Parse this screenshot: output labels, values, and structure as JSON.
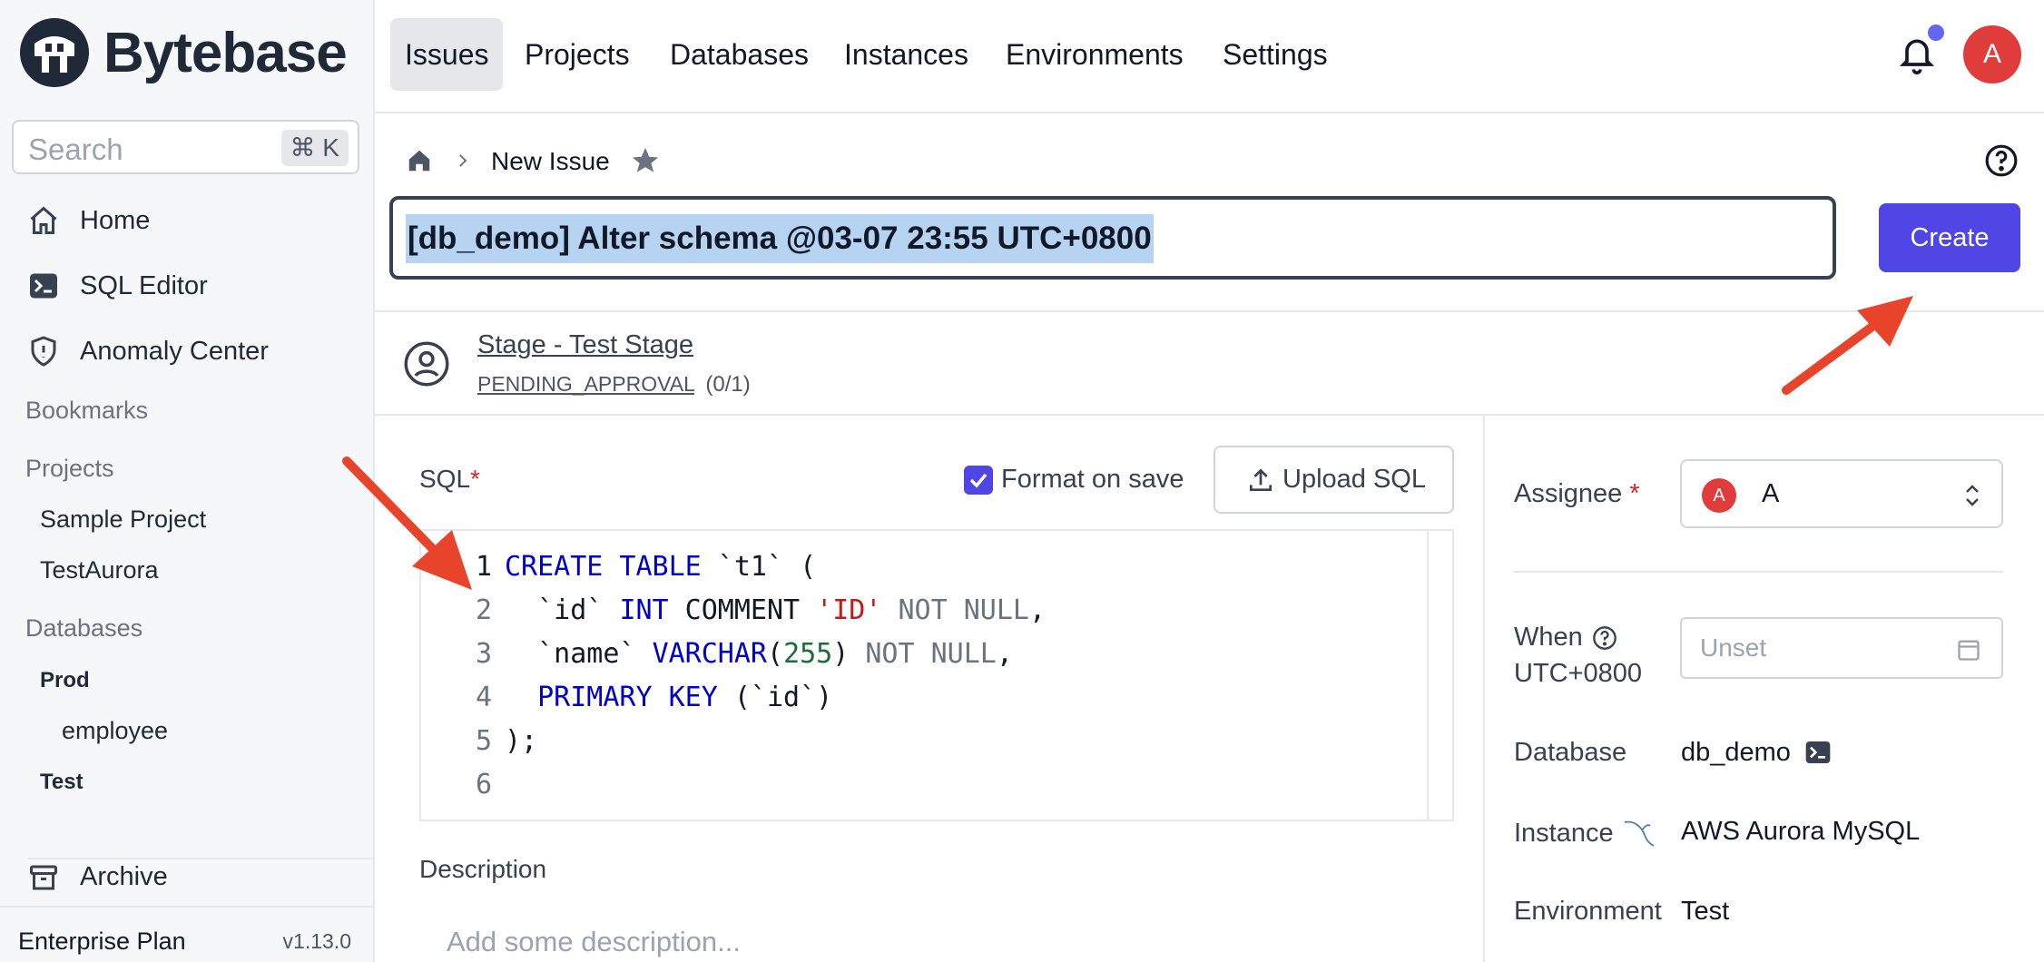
{
  "app": {
    "name": "Bytebase"
  },
  "search": {
    "placeholder": "Search",
    "shortcut": "⌘ K"
  },
  "sidebar": {
    "nav": [
      {
        "label": "Home",
        "icon": "home-icon"
      },
      {
        "label": "SQL Editor",
        "icon": "terminal-icon"
      },
      {
        "label": "Anomaly Center",
        "icon": "shield-icon"
      }
    ],
    "bookmarks_label": "Bookmarks",
    "projects_label": "Projects",
    "projects": [
      "Sample Project",
      "TestAurora"
    ],
    "databases_label": "Databases",
    "env_prod": "Prod",
    "db_employee": "employee",
    "env_test": "Test",
    "archive_label": "Archive",
    "plan": "Enterprise Plan",
    "version": "v1.13.0"
  },
  "topnav": {
    "tabs": [
      "Issues",
      "Projects",
      "Databases",
      "Instances",
      "Environments",
      "Settings"
    ],
    "active_tab": "Issues",
    "avatar_letter": "A"
  },
  "breadcrumb": {
    "current": "New Issue"
  },
  "issue": {
    "title": "[db_demo] Alter schema @03-07 23:55 UTC+0800",
    "create_label": "Create"
  },
  "stage": {
    "name": "Stage - Test Stage",
    "status": "PENDING_APPROVAL",
    "progress": "(0/1)"
  },
  "sql": {
    "label": "SQL",
    "required_mark": "*",
    "format_on_save_label": "Format on save",
    "format_on_save_checked": true,
    "upload_label": "Upload SQL",
    "line_numbers": [
      "1",
      "2",
      "3",
      "4",
      "5",
      "6"
    ]
  },
  "description": {
    "label": "Description",
    "placeholder": "Add some description..."
  },
  "details": {
    "assignee_label": "Assignee",
    "required_mark": "*",
    "assignee_avatar": "A",
    "assignee_name": "A",
    "when_label": "When",
    "when_tz": "UTC+0800",
    "when_placeholder": "Unset",
    "database_label": "Database",
    "database_value": "db_demo",
    "instance_label": "Instance",
    "instance_value": "AWS Aurora MySQL",
    "environment_label": "Environment",
    "environment_value": "Test"
  },
  "colors": {
    "accent": "#4f46e5",
    "avatar": "#e03c3c",
    "arrow": "#e8442c",
    "selection": "#b6d4f2"
  }
}
